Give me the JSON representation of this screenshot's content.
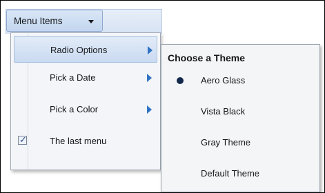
{
  "menu": {
    "trigger_label": "Menu Items",
    "items": [
      {
        "label": "Radio Options",
        "has_submenu": true,
        "active": true
      },
      {
        "label": "Pick a Date",
        "has_submenu": true
      },
      {
        "label": "Pick a Color",
        "has_submenu": true
      },
      {
        "label": "The last menu",
        "checked": true,
        "check_mark": "✓"
      }
    ]
  },
  "submenu": {
    "heading": "Choose a Theme",
    "options": [
      {
        "label": "Aero Glass",
        "selected": true
      },
      {
        "label": "Vista Black"
      },
      {
        "label": "Gray Theme"
      },
      {
        "label": "Default Theme"
      }
    ]
  },
  "colors": {
    "accent_arrow": "#2f72c5",
    "radio_dot": "#13294b",
    "highlight": "#c9daf1"
  }
}
